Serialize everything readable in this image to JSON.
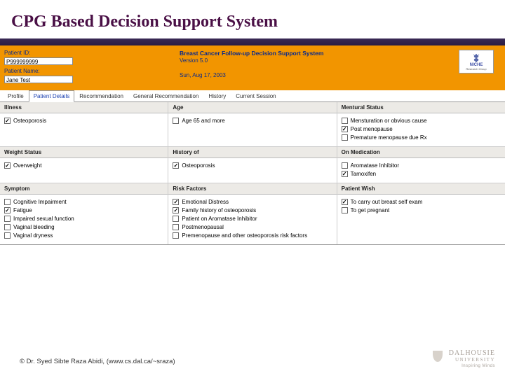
{
  "slide_title": "CPG Based Decision Support System",
  "header": {
    "patient_id_label": "Patient ID:",
    "patient_id_value": "P999999999",
    "patient_name_label": "Patient Name:",
    "patient_name_value": "Jane Test",
    "app_title": "Breast Cancer Follow-up Decision Support System",
    "app_version": "Version 5.0",
    "date": "Sun, Aug 17, 2003",
    "logo_text": "NICHE",
    "logo_sub": "Research Group"
  },
  "tabs": [
    {
      "label": "Profile"
    },
    {
      "label": "Patient Details"
    },
    {
      "label": "Recommendation"
    },
    {
      "label": "General Recommendation"
    },
    {
      "label": "History"
    },
    {
      "label": "Current Session"
    }
  ],
  "active_tab": 1,
  "sections": {
    "illness": {
      "title": "Illness",
      "options": [
        {
          "label": "Osteoporosis",
          "checked": true
        }
      ]
    },
    "age": {
      "title": "Age",
      "options": [
        {
          "label": "Age 65 and more",
          "checked": false
        }
      ]
    },
    "mentural_status": {
      "title": "Mentural Status",
      "options": [
        {
          "label": "Mensturation or obvious cause",
          "checked": false
        },
        {
          "label": "Post menopause",
          "checked": true
        },
        {
          "label": "Premature menopause due Rx",
          "checked": false
        }
      ]
    },
    "weight_status": {
      "title": "Weight Status",
      "options": [
        {
          "label": "Overweight",
          "checked": true
        }
      ]
    },
    "history_of": {
      "title": "History of",
      "options": [
        {
          "label": "Osteoporosis",
          "checked": true
        }
      ]
    },
    "on_medication": {
      "title": "On Medication",
      "options": [
        {
          "label": "Aromatase Inhibitor",
          "checked": false
        },
        {
          "label": "Tamoxifen",
          "checked": true
        }
      ]
    },
    "symptom": {
      "title": "Symptom",
      "options": [
        {
          "label": "Cognitive Impairment",
          "checked": false
        },
        {
          "label": "Fatigue",
          "checked": true
        },
        {
          "label": "Impaired sexual function",
          "checked": false
        },
        {
          "label": "Vaginal bleeding",
          "checked": false
        },
        {
          "label": "Vaginal dryness",
          "checked": false
        }
      ]
    },
    "risk_factors": {
      "title": "Risk Factors",
      "options": [
        {
          "label": "Emotional Distress",
          "checked": true
        },
        {
          "label": "Family history of osteoporosis",
          "checked": true
        },
        {
          "label": "Patient on Aromatase Inhibitor",
          "checked": false
        },
        {
          "label": "Postmenopausal",
          "checked": false
        },
        {
          "label": "Premenopause and other osteoporosis risk factors",
          "checked": false
        }
      ]
    },
    "patient_wish": {
      "title": "Patient Wish",
      "options": [
        {
          "label": "To carry out breast self exam",
          "checked": true
        },
        {
          "label": "To get pregnant",
          "checked": false
        }
      ]
    }
  },
  "footer": "©  Dr. Syed Sibte Raza Abidi, (www.cs.dal.ca/~sraza)",
  "dal": {
    "name_top": "DALHOUSIE",
    "name_bot": "UNIVERSITY",
    "tag": "Inspiring Minds"
  }
}
